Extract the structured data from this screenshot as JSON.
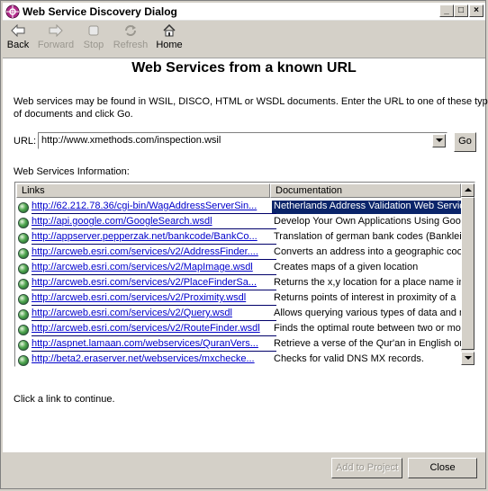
{
  "window": {
    "title": "Web Service Discovery Dialog",
    "controls": [
      "_",
      "□",
      "×"
    ]
  },
  "toolbar": {
    "back": {
      "label": "Back",
      "icon": "arrow-left-icon",
      "enabled": true
    },
    "forward": {
      "label": "Forward",
      "icon": "arrow-right-icon",
      "enabled": false
    },
    "stop": {
      "label": "Stop",
      "icon": "stop-icon",
      "enabled": false
    },
    "refresh": {
      "label": "Refresh",
      "icon": "refresh-icon",
      "enabled": false
    },
    "home": {
      "label": "Home",
      "icon": "home-icon",
      "enabled": true
    }
  },
  "main": {
    "heading": "Web Services from a known URL",
    "instructions_line1": "Web services may be found in WSIL, DISCO, HTML or WSDL documents. Enter the URL to one of these types",
    "instructions_line2": "of documents and click Go.",
    "url_label": "URL:",
    "url_value": "http://www.xmethods.com/inspection.wsil",
    "go_label": "Go",
    "services_label": "Web Services Information:",
    "columns": {
      "links": "Links",
      "documentation": "Documentation"
    },
    "rows": [
      {
        "link": "http://62.212.78.36/cgi-bin/WagAddressServerSin...",
        "doc": "Netherlands Address Validation Web Service"
      },
      {
        "link": "http://api.google.com/GoogleSearch.wsdl",
        "doc": "Develop Your Own Applications Using Google"
      },
      {
        "link": "http://appserver.pepperzak.net/bankcode/BankCo...",
        "doc": "Translation of german bank codes (Bankleitzahlen)"
      },
      {
        "link": "http://arcweb.esri.com/services/v2/AddressFinder....",
        "doc": "Converts an address into a geographic coordinate"
      },
      {
        "link": "http://arcweb.esri.com/services/v2/MapImage.wsdl",
        "doc": "Creates maps of a given location"
      },
      {
        "link": "http://arcweb.esri.com/services/v2/PlaceFinderSa...",
        "doc": "Returns the x,y location for a place name in"
      },
      {
        "link": "http://arcweb.esri.com/services/v2/Proximity.wsdl",
        "doc": "Returns points of interest in proximity of a"
      },
      {
        "link": "http://arcweb.esri.com/services/v2/Query.wsdl",
        "doc": "Allows querying various types of data and map"
      },
      {
        "link": "http://arcweb.esri.com/services/v2/RouteFinder.wsdl",
        "doc": "Finds the optimal route between two or more"
      },
      {
        "link": "http://aspnet.lamaan.com/webservices/QuranVers...",
        "doc": "Retrieve a verse of the Qur'an in English or"
      },
      {
        "link": "http://beta2.eraserver.net/webservices/mxchecke...",
        "doc": "Checks for valid DNS MX records."
      }
    ],
    "selected_row": 0,
    "hint": "Click a link to continue."
  },
  "footer": {
    "add_label": "Add to Project",
    "add_enabled": false,
    "close_label": "Close"
  },
  "colors": {
    "selection": "#0a246a",
    "link": "#0000cc",
    "chrome": "#d4d0c8"
  }
}
